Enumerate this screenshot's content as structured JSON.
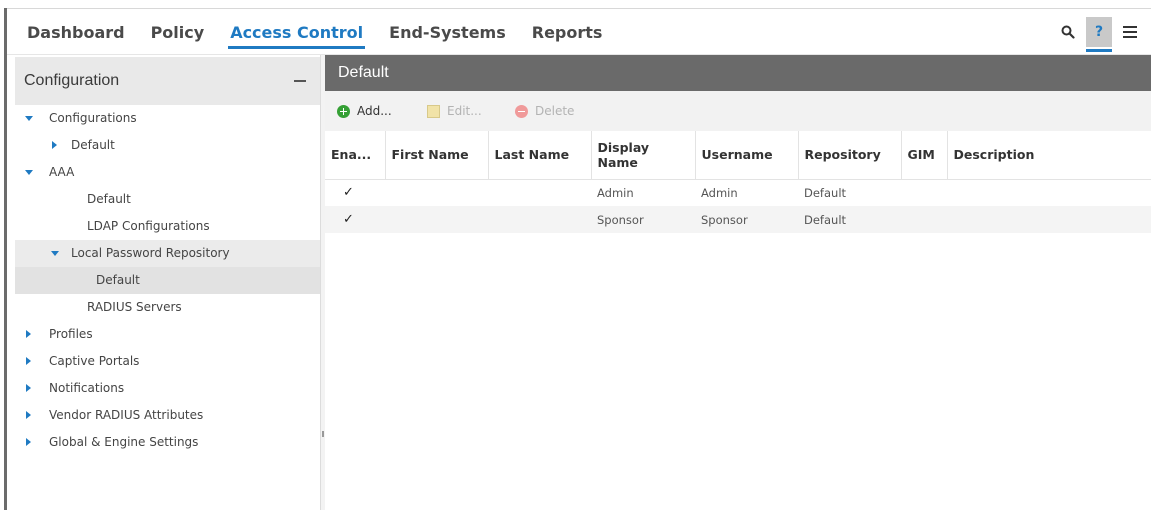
{
  "topnav": {
    "tabs": [
      {
        "label": "Dashboard",
        "active": false
      },
      {
        "label": "Policy",
        "active": false
      },
      {
        "label": "Access Control",
        "active": true
      },
      {
        "label": "End-Systems",
        "active": false
      },
      {
        "label": "Reports",
        "active": false
      }
    ],
    "tools": [
      {
        "icon": "search-icon"
      },
      {
        "icon": "help-icon",
        "label": "?",
        "active": true
      },
      {
        "icon": "menu-icon"
      }
    ],
    "accent_color": "#1f7ac2"
  },
  "sidebar": {
    "title": "Configuration",
    "collapse_icon": "minus-icon",
    "tree": [
      {
        "label": "Configurations",
        "expander": "expanded"
      },
      {
        "label": "Default",
        "expander": "collapsed"
      },
      {
        "label": "AAA",
        "expander": "expanded"
      },
      {
        "label": "Default",
        "expander": "none"
      },
      {
        "label": "LDAP Configurations",
        "expander": "none"
      },
      {
        "label": "Local Password Repository",
        "expander": "expanded"
      },
      {
        "label": "Default",
        "expander": "none",
        "selected": true
      },
      {
        "label": "RADIUS Servers",
        "expander": "none"
      },
      {
        "label": "Profiles",
        "expander": "collapsed"
      },
      {
        "label": "Captive Portals",
        "expander": "collapsed"
      },
      {
        "label": "Notifications",
        "expander": "collapsed"
      },
      {
        "label": "Vendor RADIUS Attributes",
        "expander": "collapsed"
      },
      {
        "label": "Global & Engine Settings",
        "expander": "collapsed"
      }
    ]
  },
  "main": {
    "title": "Default",
    "toolbar": {
      "add": {
        "label": "Add...",
        "icon": "add-icon",
        "enabled": true
      },
      "edit": {
        "label": "Edit...",
        "icon": "edit-icon",
        "enabled": false
      },
      "delete": {
        "label": "Delete",
        "icon": "delete-icon",
        "enabled": false
      }
    },
    "table": {
      "columns": [
        "Ena...",
        "First Name",
        "Last Name",
        "Display Name",
        "Username",
        "Repository",
        "GIM",
        "Description"
      ],
      "rows": [
        {
          "enabled": "✓",
          "first_name": "",
          "last_name": "",
          "display_name": "Admin",
          "username": "Admin",
          "repository": "Default",
          "gim": "",
          "description": ""
        },
        {
          "enabled": "✓",
          "first_name": "",
          "last_name": "",
          "display_name": "Sponsor",
          "username": "Sponsor",
          "repository": "Default",
          "gim": "",
          "description": ""
        }
      ]
    }
  }
}
